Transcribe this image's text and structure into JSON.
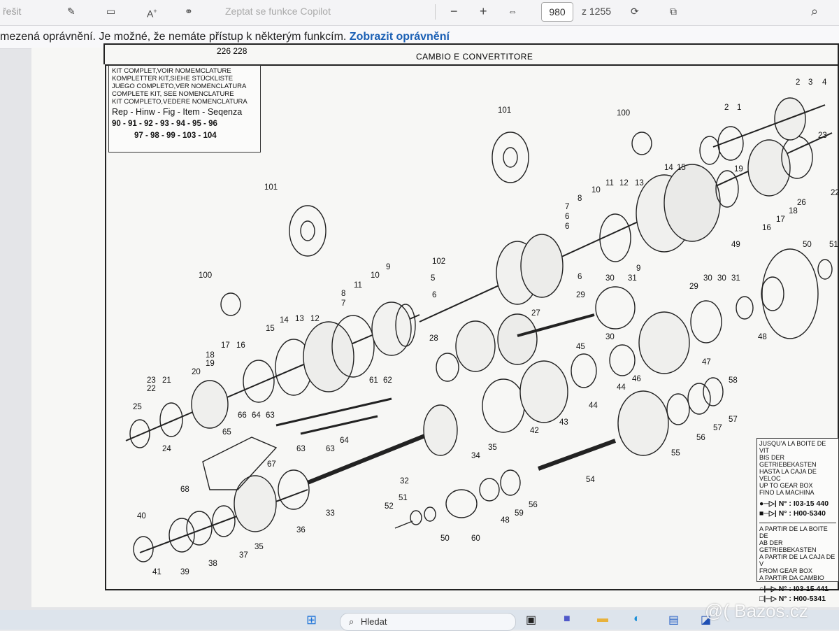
{
  "toolbar": {
    "partial_left": "řešit",
    "font_size_label": "A",
    "copilot_placeholder": "Zeptat se funkce Copilot",
    "minus": "−",
    "plus": "+",
    "current_page": "980",
    "page_total": "z 1255"
  },
  "infobar": {
    "message": "mezená oprávnění. Je možné, že nemáte přístup k některým funkcím.",
    "link": "Zobrazit oprávnění"
  },
  "doc_header": {
    "ref": "226 228",
    "title": "CAMBIO E CONVERTITORE"
  },
  "kit_box": {
    "lines": [
      "KIT COMPLET,VOIR NOMEMCLATURE",
      "KOMPLETTER KIT,SIEHE STÜCKLISTE",
      "JUEGO COMPLETO,VER NOMENCLATURA",
      "COMPLETE KIT, SEE NOMENCLATURE",
      "KIT COMPLETO,VEDERE NOMENCLATURA"
    ],
    "rep_line": "Rep - Hinw - Fig - Item - Seqenza",
    "nums_1": "90 - 91 - 92 - 93 - 94 - 95 - 96",
    "nums_2": "97 - 98 - 99 - 103 - 104"
  },
  "legend": {
    "up_to": [
      "JUSQU'A LA BOITE DE VIT",
      "BIS DER GETRIEBEKASTEN",
      "HASTA LA CAJA DE VELOC",
      "UP TO GEAR BOX",
      "FINO LA MACHINA"
    ],
    "n1": "N° : I03-15 440",
    "n2": "N° : H00-5340",
    "from": [
      "A PARTIR DE LA BOITE DE",
      "AB DER GETRIEBEKASTEN",
      "A PARTIR DE LA CAJA DE V",
      "FROM GEAR BOX",
      "A PARTIR DA CAMBIO"
    ],
    "n3": "N° : I03-15 441",
    "n4": "N° : H00-5341"
  },
  "parts_labels": [
    "101",
    "100",
    "102",
    "1",
    "2",
    "3",
    "4",
    "5",
    "6",
    "7",
    "8",
    "9",
    "10",
    "11",
    "12",
    "13",
    "14",
    "15",
    "16",
    "17",
    "18",
    "19",
    "20",
    "21",
    "22",
    "23",
    "24",
    "25",
    "26",
    "27",
    "28",
    "29",
    "30",
    "31",
    "32",
    "33",
    "34",
    "35",
    "36",
    "37",
    "38",
    "39",
    "40",
    "41",
    "42",
    "43",
    "44",
    "45",
    "46",
    "47",
    "48",
    "49",
    "50",
    "51",
    "52",
    "54",
    "55",
    "56",
    "57",
    "58",
    "59",
    "60",
    "61",
    "62",
    "63",
    "64",
    "65",
    "66",
    "67",
    "68"
  ],
  "taskbar": {
    "search": "Hledat"
  },
  "watermark": "@( Bazos.cz"
}
